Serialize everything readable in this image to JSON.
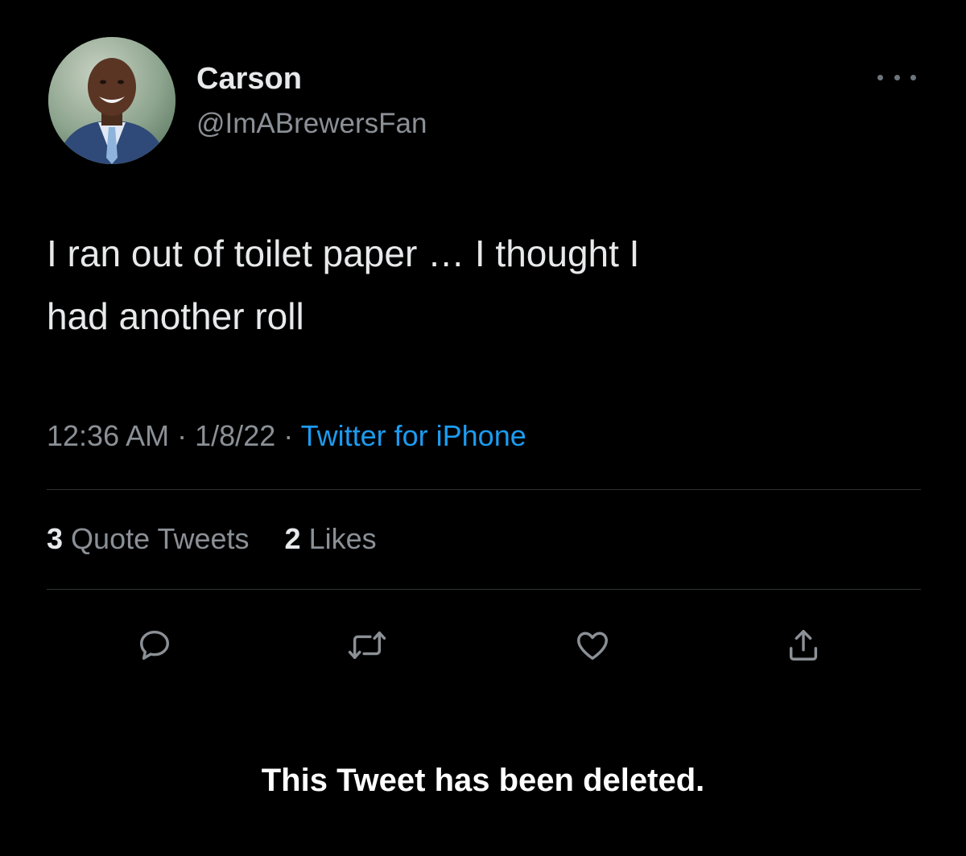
{
  "tweet": {
    "author": {
      "display_name": "Carson",
      "handle": "@ImABrewersFan",
      "avatar": "profile-photo"
    },
    "text_line_1": "I ran out of toilet paper … I thought I",
    "text_line_2": "had another roll",
    "meta": {
      "time": "12:36 AM",
      "separator": "·",
      "date": "1/8/22",
      "source": "Twitter for iPhone"
    },
    "stats": {
      "quote_tweets_count": "3",
      "quote_tweets_label": "Quote Tweets",
      "likes_count": "2",
      "likes_label": "Likes"
    },
    "actions": [
      {
        "name": "reply",
        "icon": "speech-bubble-icon"
      },
      {
        "name": "retweet",
        "icon": "retweet-icon"
      },
      {
        "name": "like",
        "icon": "heart-icon"
      },
      {
        "name": "share",
        "icon": "share-icon"
      }
    ]
  },
  "notice": "This Tweet has been deleted.",
  "colors": {
    "background": "#000000",
    "primary_text": "#e7e9ea",
    "secondary_text": "#8b9096",
    "link": "#1d9bf0",
    "divider": "#2f3336"
  }
}
